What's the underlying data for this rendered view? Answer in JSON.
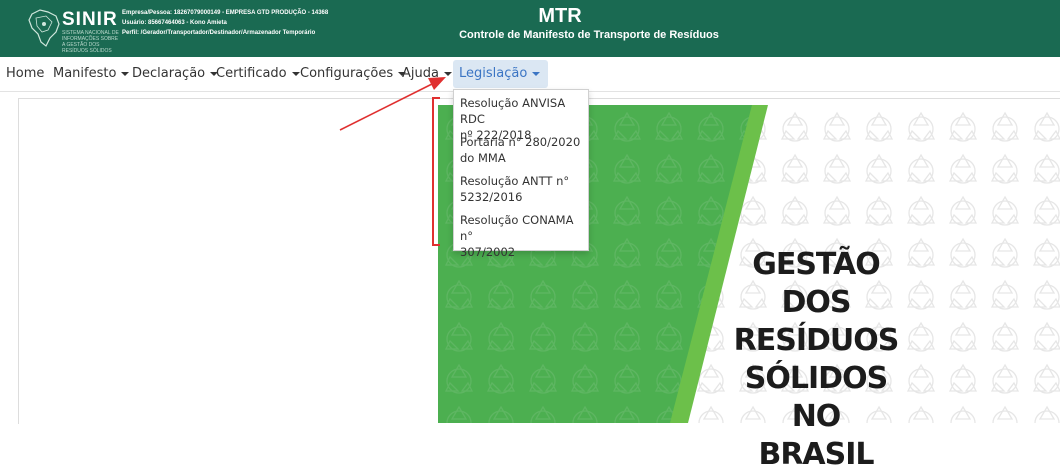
{
  "header": {
    "logo_text": "SINIR",
    "logo_subtitle": "SISTEMA NACIONAL DE INFORMAÇÕES SOBRE A GESTÃO DOS RESÍDUOS SÓLIDOS",
    "company_line": "Empresa/Pessoa: 18267079000149 - EMPRESA GTD PRODUÇÃO - 14368",
    "user_line": "Usuário: 85667464063 - Kono Amieta",
    "profile_line": "Perfil: /Gerador/Transportador/Destinador/Armazenador Temporário",
    "app_title": "MTR",
    "app_subtitle": "Controle de Manifesto de Transporte de Resíduos"
  },
  "nav": {
    "items": [
      {
        "label": "Home",
        "has_caret": false
      },
      {
        "label": "Manifesto",
        "has_caret": true
      },
      {
        "label": "Declaração",
        "has_caret": true
      },
      {
        "label": "Certificado",
        "has_caret": true
      },
      {
        "label": "Configurações",
        "has_caret": true
      },
      {
        "label": "Ajuda",
        "has_caret": true
      },
      {
        "label": "Legislação",
        "has_caret": true,
        "active": true
      }
    ]
  },
  "dropdown": {
    "items": [
      {
        "line1": "Resolução ANVISA RDC",
        "line2": "nº 222/2018"
      },
      {
        "line1": "Portaria n° 280/2020",
        "line2": "do MMA"
      },
      {
        "line1": "Resolução ANTT n°",
        "line2": "5232/2016"
      },
      {
        "line1": "Resolução CONAMA n°",
        "line2": "307/2002"
      }
    ]
  },
  "banner": {
    "line1": "GESTÃO DOS",
    "line2": "RESÍDUOS",
    "line3": "SÓLIDOS",
    "line4": "NO BRASIL"
  },
  "colors": {
    "header_bg": "#1a6a52",
    "active_tab_bg": "#dbe7f3",
    "active_tab_text": "#3b75c4",
    "banner_green": "#4caf50",
    "banner_light_green": "#6cc04a",
    "annotation_red": "#e03030"
  }
}
